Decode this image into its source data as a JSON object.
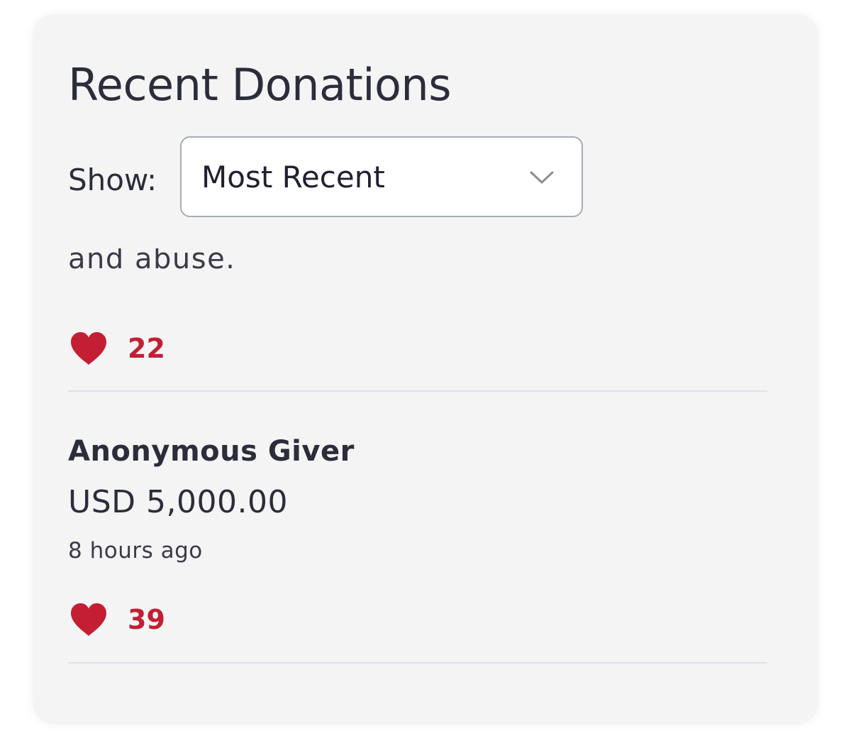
{
  "panel": {
    "title": "Recent Donations",
    "show_label": "Show:",
    "sort_select": {
      "selected": "Most Recent"
    }
  },
  "donations": [
    {
      "message_fragment": "and abuse.",
      "likes": "22"
    },
    {
      "name": "Anonymous Giver",
      "amount": "USD 5,000.00",
      "time": "8 hours ago",
      "likes": "39"
    }
  ],
  "icons": {
    "heart": "heart-icon",
    "select_arrow": "chevron-down-icon"
  },
  "colors": {
    "card_background": "#f4f4f5",
    "heart": "#c41e34",
    "like_count": "#c41e34",
    "text": "#2c2d3a",
    "divider": "#dfe1e8"
  }
}
